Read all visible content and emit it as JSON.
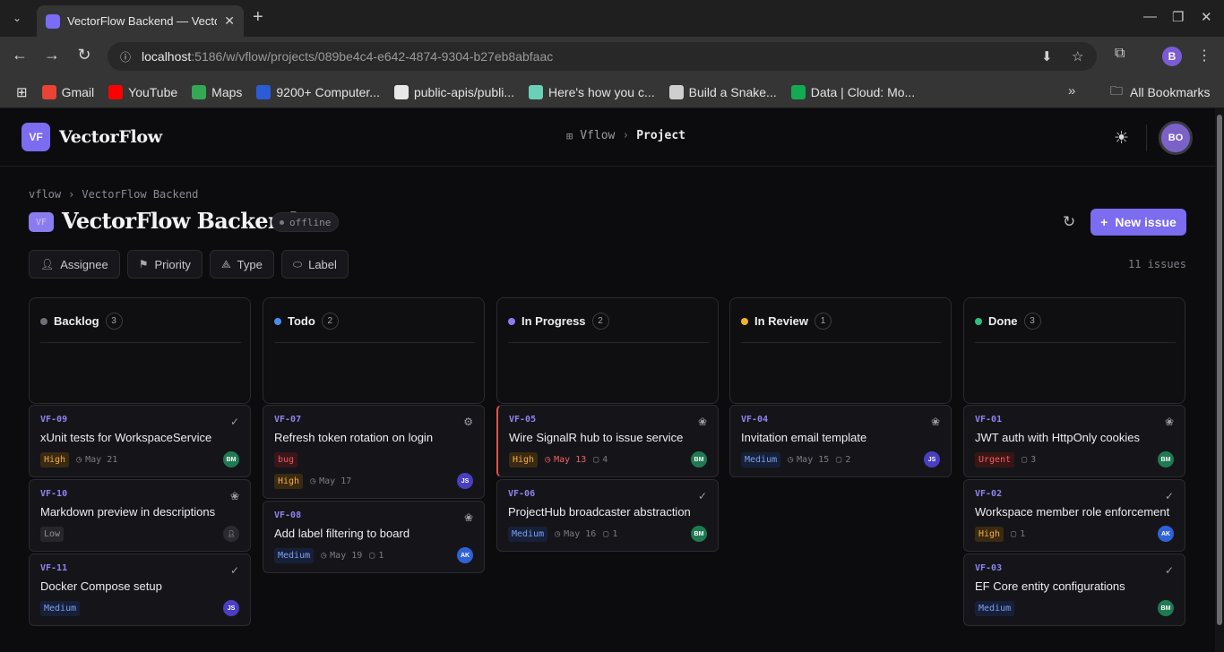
{
  "browser": {
    "tab_title": "VectorFlow Backend — VectorFlow",
    "url_host": "localhost",
    "url_path": ":5186/w/vflow/projects/089be4c4-e642-4874-9304-b27eb8abfaac",
    "profile_initial": "B",
    "bookmarks": [
      {
        "label": "Gmail",
        "color": "#ea4335"
      },
      {
        "label": "YouTube",
        "color": "#ff0000"
      },
      {
        "label": "Maps",
        "color": "#34a853"
      },
      {
        "label": "9200+ Computer...",
        "color": "#2b5bd7"
      },
      {
        "label": "public-apis/publi...",
        "color": "#e8e8e8"
      },
      {
        "label": "Here's how you c...",
        "color": "#6bd0b8"
      },
      {
        "label": "Build a Snake...",
        "color": "#cfcfcf"
      },
      {
        "label": "Data | Cloud: Mo...",
        "color": "#13aa52"
      }
    ],
    "all_bookmarks": "All Bookmarks"
  },
  "app": {
    "logo_initials": "VF",
    "logo_name": "VectorFlow",
    "nav_workspace": "Vflow",
    "nav_current": "Project",
    "user_initials": "BO",
    "breadcrumb_workspace": "vflow",
    "breadcrumb_project": "VectorFlow Backend",
    "project_initials": "VF",
    "project_title": "VectorFlow Backend",
    "status_badge": "offline",
    "new_issue_label": "New issue",
    "filters": [
      "Assignee",
      "Priority",
      "Type",
      "Label"
    ],
    "issue_count": "11 issues"
  },
  "columns": [
    {
      "name": "Backlog",
      "count": "3",
      "color": "#6f6f77",
      "cards": [
        {
          "id": "VF-09",
          "title": "xUnit tests for WorkspaceService",
          "priority": "High",
          "date": "May 21",
          "assignee": "BM"
        },
        {
          "id": "VF-10",
          "title": "Markdown preview in descriptions",
          "priority": "Low",
          "assignee": ""
        },
        {
          "id": "VF-11",
          "title": "Docker Compose setup",
          "priority": "Medium",
          "assignee": "JS"
        }
      ]
    },
    {
      "name": "Todo",
      "count": "2",
      "color": "#4a8df0",
      "cards": [
        {
          "id": "VF-07",
          "title": "Refresh token rotation on login",
          "label": "bug",
          "priority": "High",
          "date": "May 17",
          "assignee": "JS"
        },
        {
          "id": "VF-08",
          "title": "Add label filtering to board",
          "priority": "Medium",
          "date": "May 19",
          "comments": "1",
          "assignee": "AK"
        }
      ]
    },
    {
      "name": "In Progress",
      "count": "2",
      "color": "#8a7cf0",
      "cards": [
        {
          "id": "VF-05",
          "title": "Wire SignalR hub to issue service",
          "priority": "High",
          "date": "May 13",
          "comments": "4",
          "assignee": "BM"
        },
        {
          "id": "VF-06",
          "title": "ProjectHub broadcaster abstraction",
          "priority": "Medium",
          "date": "May 16",
          "comments": "1",
          "assignee": "BM"
        }
      ]
    },
    {
      "name": "In Review",
      "count": "1",
      "color": "#f0b429",
      "cards": [
        {
          "id": "VF-04",
          "title": "Invitation email template",
          "priority": "Medium",
          "date": "May 15",
          "comments": "2",
          "assignee": "JS"
        }
      ]
    },
    {
      "name": "Done",
      "count": "3",
      "color": "#2fbf7a",
      "cards": [
        {
          "id": "VF-01",
          "title": "JWT auth with HttpOnly cookies",
          "priority": "Urgent",
          "comments": "3",
          "assignee": "BM"
        },
        {
          "id": "VF-02",
          "title": "Workspace member role enforcement",
          "priority": "High",
          "comments": "1",
          "assignee": "AK"
        },
        {
          "id": "VF-03",
          "title": "EF Core entity configurations",
          "priority": "Medium",
          "assignee": "BM"
        }
      ]
    }
  ]
}
